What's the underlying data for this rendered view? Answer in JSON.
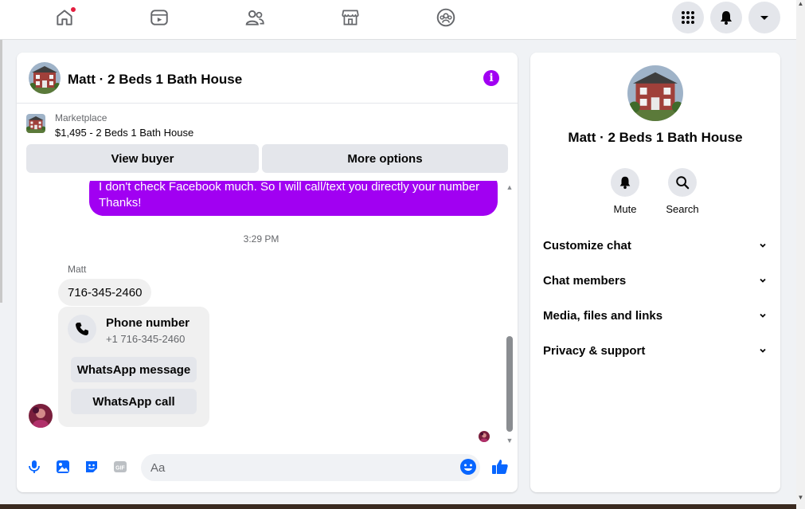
{
  "colors": {
    "accent": "#a100f2",
    "fb_blue": "#0866ff",
    "notification": "#e41e3f"
  },
  "topnav": {
    "icons": [
      "home-icon",
      "video-icon",
      "friends-icon",
      "marketplace-icon",
      "groups-icon"
    ],
    "right_icons": [
      "menu-grid-icon",
      "bell-icon",
      "account-caret-icon"
    ]
  },
  "chat": {
    "title": "Matt · 2 Beds 1 Bath House",
    "marketplace_label": "Marketplace",
    "listing": "$1,495 - 2 Beds 1 Bath House",
    "view_buyer": "View buyer",
    "more_options": "More options",
    "messages": {
      "outgoing_line1": "I don't check Facebook much. So I will call/text you directly your number",
      "outgoing_line2": "Thanks!",
      "timestamp": "3:29 PM",
      "sender": "Matt",
      "incoming_phone": "716-345-2460",
      "phone_card_title": "Phone number",
      "phone_card_sub": "+1 716-345-2460",
      "whatsapp_message": "WhatsApp message",
      "whatsapp_call": "WhatsApp call"
    },
    "composer": {
      "placeholder": "Aa"
    }
  },
  "right_panel": {
    "name": "Matt · 2 Beds 1 Bath House",
    "actions": [
      {
        "label": "Mute",
        "icon": "bell-icon"
      },
      {
        "label": "Search",
        "icon": "search-icon"
      }
    ],
    "sections": [
      "Customize chat",
      "Chat members",
      "Media, files and links",
      "Privacy & support"
    ]
  }
}
